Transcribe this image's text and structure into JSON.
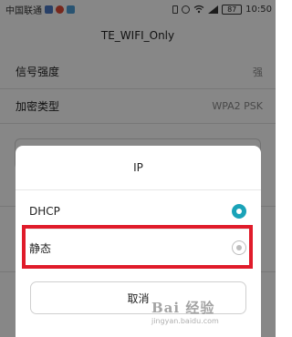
{
  "status_bar": {
    "carrier": "中国联通",
    "battery": "87",
    "time": "10:50"
  },
  "title": "TE_WIFI_Only",
  "rows": [
    {
      "label": "信号强度",
      "value": "强"
    },
    {
      "label": "加密类型",
      "value": "WPA2 PSK"
    }
  ],
  "dialog": {
    "title": "IP",
    "options": [
      {
        "label": "DHCP",
        "selected": true
      },
      {
        "label": "静态",
        "selected": false
      }
    ],
    "cancel_label": "取消"
  },
  "colors": {
    "accent": "#1aa3b8",
    "highlight": "#e01b2a",
    "scrim": "rgba(0,0,0,0.47)"
  },
  "icons": [
    "shield-icon",
    "weibo-icon",
    "photo-icon",
    "phone-icon",
    "alarm-icon",
    "wifi-icon",
    "signal-icon",
    "battery-icon"
  ],
  "watermark": {
    "main": "Bai 经验",
    "sub": "jingyan.baidu.com"
  }
}
